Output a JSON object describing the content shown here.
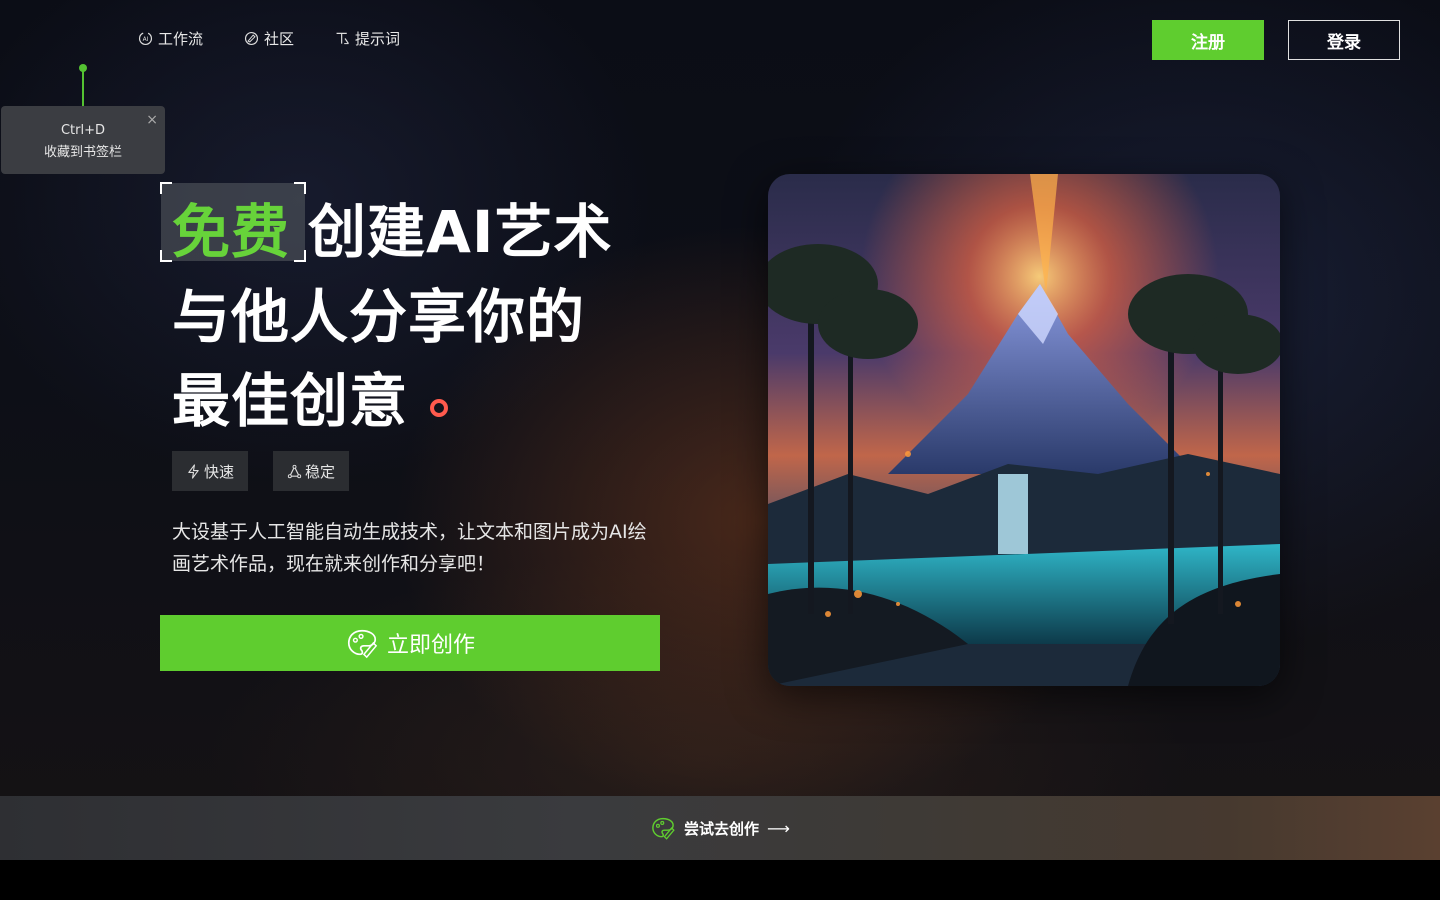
{
  "nav": {
    "items": [
      {
        "label": "工作流",
        "icon": "ai-workflow-icon"
      },
      {
        "label": "社区",
        "icon": "community-icon"
      },
      {
        "label": "提示词",
        "icon": "prompt-icon"
      }
    ],
    "register_label": "注册",
    "login_label": "登录"
  },
  "bookmark_tip": {
    "shortcut": "Ctrl+D",
    "text": "收藏到书签栏",
    "close": "×"
  },
  "hero": {
    "highlight": "免费",
    "line1_rest": "创建AI艺术",
    "line2": "与他人分享你的",
    "line3": "最佳创意",
    "tags": [
      {
        "label": "快速",
        "icon": "lightning-icon"
      },
      {
        "label": "稳定",
        "icon": "triangle-nodes-icon"
      }
    ],
    "description": "大设基于人工智能自动生成技术，让文本和图片成为AI绘画艺术作品，现在就来创作和分享吧！",
    "cta_label": "立即创作"
  },
  "bottom_bar": {
    "label": "尝试去创作",
    "arrow": "⟶"
  },
  "colors": {
    "accent_green": "#5fcd2f",
    "highlight_green": "#67d33a",
    "dot_red": "#ff5a4d"
  }
}
